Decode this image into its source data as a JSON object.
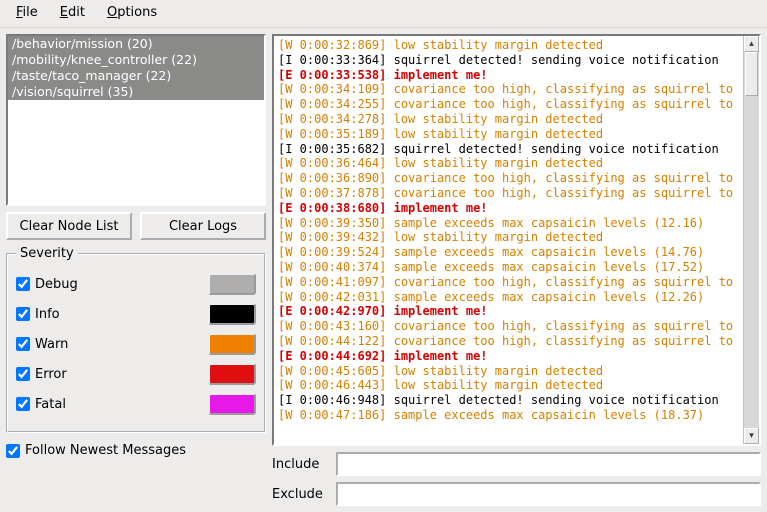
{
  "menu": {
    "file": "File",
    "edit": "Edit",
    "options": "Options"
  },
  "nodes": [
    "/behavior/mission (20)",
    "/mobility/knee_controller (22)",
    "/taste/taco_manager (22)",
    "/vision/squirrel (35)"
  ],
  "buttons": {
    "clear_nodes": "Clear Node List",
    "clear_logs": "Clear Logs"
  },
  "severity": {
    "legend": "Severity",
    "levels": [
      {
        "label": "Debug",
        "checked": true,
        "color": "#b0aead"
      },
      {
        "label": "Info",
        "checked": true,
        "color": "#000000"
      },
      {
        "label": "Warn",
        "checked": true,
        "color": "#f08000"
      },
      {
        "label": "Error",
        "checked": true,
        "color": "#e01010"
      },
      {
        "label": "Fatal",
        "checked": true,
        "color": "#e818e8"
      }
    ]
  },
  "follow": {
    "label": "Follow Newest Messages",
    "checked": true
  },
  "filters": {
    "include_label": "Include",
    "include_value": "",
    "exclude_label": "Exclude",
    "exclude_value": ""
  },
  "logs": [
    {
      "lvl": "W",
      "ts": "0:00:32:869",
      "msg": "low stability margin detected"
    },
    {
      "lvl": "I",
      "ts": "0:00:33:364",
      "msg": "squirrel detected! sending voice notification"
    },
    {
      "lvl": "E",
      "ts": "0:00:33:538",
      "msg": "implement me!"
    },
    {
      "lvl": "W",
      "ts": "0:00:34:109",
      "msg": "covariance too high, classifying as squirrel to be on sa…"
    },
    {
      "lvl": "W",
      "ts": "0:00:34:255",
      "msg": "covariance too high, classifying as squirrel to be on sa…"
    },
    {
      "lvl": "W",
      "ts": "0:00:34:278",
      "msg": "low stability margin detected"
    },
    {
      "lvl": "W",
      "ts": "0:00:35:189",
      "msg": "low stability margin detected"
    },
    {
      "lvl": "I",
      "ts": "0:00:35:682",
      "msg": "squirrel detected! sending voice notification"
    },
    {
      "lvl": "W",
      "ts": "0:00:36:464",
      "msg": "low stability margin detected"
    },
    {
      "lvl": "W",
      "ts": "0:00:36:890",
      "msg": "covariance too high, classifying as squirrel to be on sa…"
    },
    {
      "lvl": "W",
      "ts": "0:00:37:878",
      "msg": "covariance too high, classifying as squirrel to be on sa…"
    },
    {
      "lvl": "E",
      "ts": "0:00:38:680",
      "msg": "implement me!"
    },
    {
      "lvl": "W",
      "ts": "0:00:39:350",
      "msg": "sample exceeds max capsaicin levels (12.16)"
    },
    {
      "lvl": "W",
      "ts": "0:00:39:432",
      "msg": "low stability margin detected"
    },
    {
      "lvl": "W",
      "ts": "0:00:39:524",
      "msg": "sample exceeds max capsaicin levels (14.76)"
    },
    {
      "lvl": "W",
      "ts": "0:00:40:374",
      "msg": "sample exceeds max capsaicin levels (17.52)"
    },
    {
      "lvl": "W",
      "ts": "0:00:41:097",
      "msg": "covariance too high, classifying as squirrel to be on sa…"
    },
    {
      "lvl": "W",
      "ts": "0:00:42:031",
      "msg": "sample exceeds max capsaicin levels (12.26)"
    },
    {
      "lvl": "E",
      "ts": "0:00:42:970",
      "msg": "implement me!"
    },
    {
      "lvl": "W",
      "ts": "0:00:43:160",
      "msg": "covariance too high, classifying as squirrel to be on sa…"
    },
    {
      "lvl": "W",
      "ts": "0:00:44:122",
      "msg": "covariance too high, classifying as squirrel to be on sa…"
    },
    {
      "lvl": "E",
      "ts": "0:00:44:692",
      "msg": "implement me!"
    },
    {
      "lvl": "W",
      "ts": "0:00:45:605",
      "msg": "low stability margin detected"
    },
    {
      "lvl": "W",
      "ts": "0:00:46:443",
      "msg": "low stability margin detected"
    },
    {
      "lvl": "I",
      "ts": "0:00:46:948",
      "msg": "squirrel detected! sending voice notification"
    },
    {
      "lvl": "W",
      "ts": "0:00:47:186",
      "msg": "sample exceeds max capsaicin levels (18.37)"
    }
  ]
}
